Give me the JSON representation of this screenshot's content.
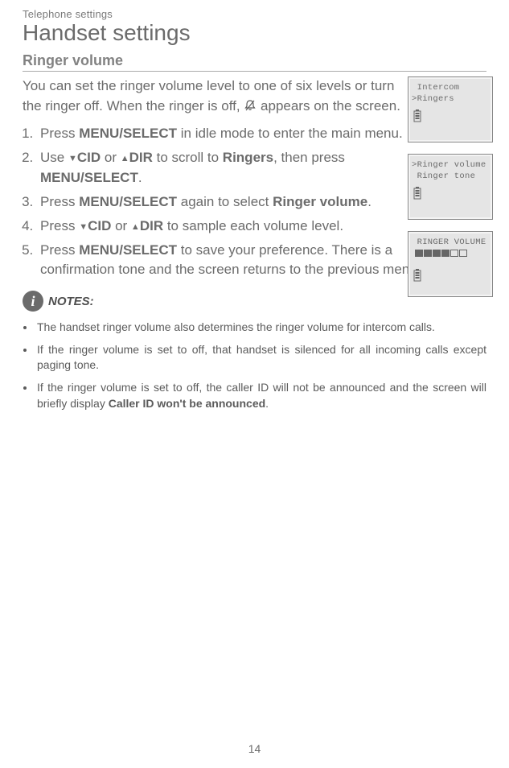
{
  "breadcrumb": "Telephone settings",
  "title": "Handset settings",
  "section": "Ringer volume",
  "intro_a": "You can set the ringer volume level to one of six levels or turn the ringer off. When the ringer is off, ",
  "intro_b": " appears on the screen.",
  "steps": {
    "s1a": "Press ",
    "s1b": "MENU/SELECT",
    "s1c": " in idle mode to enter the main menu.",
    "s2a": "Use ",
    "s2cid": "CID",
    "s2or": " or ",
    "s2dir": "DIR",
    "s2b": " to scroll to ",
    "s2ringers": "Ringers",
    "s2c": ", then press ",
    "s2d": "MENU/SELECT",
    "s2e": ".",
    "s3a": "Press ",
    "s3b": "MENU/SELECT",
    "s3c": " again to select ",
    "s3d": "Ringer volume",
    "s3e": ".",
    "s4a": "Press ",
    "s4b": " or ",
    "s4c": " to sample each volume level.",
    "s5a": "Press ",
    "s5b": "MENU/SELECT",
    "s5c": " to save your preference. There is a confirmation tone and the screen returns to the previous menu."
  },
  "notes_label": "NOTES:",
  "notes": {
    "n1": "The handset ringer volume also determines the ringer volume for intercom calls.",
    "n2": "If the ringer volume is set to off, that handset is silenced for all incoming calls except paging tone.",
    "n3a": "If the ringer volume is set to off, the caller ID will not be announced and the screen will briefly display ",
    "n3b": "Caller ID won't be announced",
    "n3c": "."
  },
  "screens": {
    "a1": " Intercom",
    "a2": ">Ringers",
    "b1": ">Ringer volume",
    "b2": " Ringer tone",
    "c1": " RINGER VOLUME"
  },
  "chart_data": {
    "type": "bar",
    "title": "RINGER VOLUME",
    "categories": [
      "1",
      "2",
      "3",
      "4",
      "5",
      "6"
    ],
    "values": [
      1,
      1,
      1,
      1,
      0,
      0
    ],
    "ylim": [
      0,
      1
    ]
  },
  "page_number": "14"
}
